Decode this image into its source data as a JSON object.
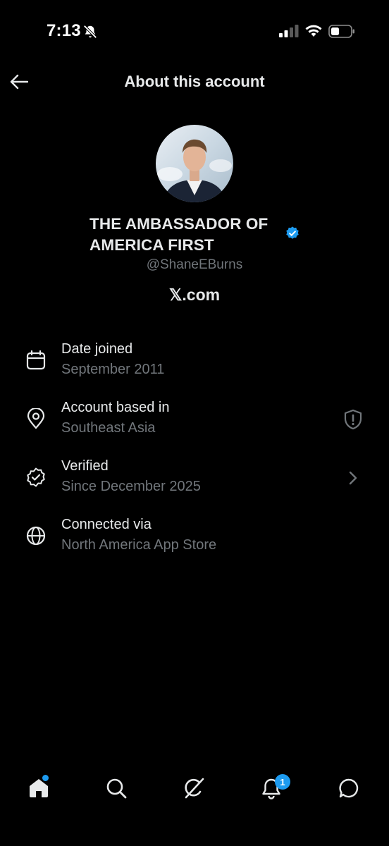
{
  "status_bar": {
    "time": "7:13",
    "icons": [
      "bell-off-icon",
      "signal-icon",
      "wifi-icon",
      "battery-icon"
    ]
  },
  "header": {
    "title": "About this account",
    "back_icon": "back-arrow-icon"
  },
  "profile": {
    "display_name_line1": "THE AMBASSADOR OF",
    "display_name_line2": "AMERICA FIRST",
    "verified": true,
    "handle": "@ShaneEBurns",
    "site": "𝕏.com"
  },
  "info": [
    {
      "icon": "calendar-icon",
      "title": "Date joined",
      "value": "September 2011"
    },
    {
      "icon": "location-pin-icon",
      "title": "Account based in",
      "value": "Southeast Asia",
      "trailing_icon": "shield-alert-icon"
    },
    {
      "icon": "verified-badge-icon",
      "title": "Verified",
      "value": "Since December 2025",
      "trailing_icon": "chevron-right-icon"
    },
    {
      "icon": "globe-icon",
      "title": "Connected via",
      "value": "North America App Store"
    }
  ],
  "bottom_nav": {
    "items": [
      "home-icon",
      "search-icon",
      "grok-icon",
      "notifications-icon",
      "messages-icon"
    ],
    "notifications_count": "1"
  },
  "colors": {
    "background": "#000000",
    "text_primary": "#e7e9ea",
    "text_secondary": "#71767b",
    "accent": "#1d9bf0"
  }
}
